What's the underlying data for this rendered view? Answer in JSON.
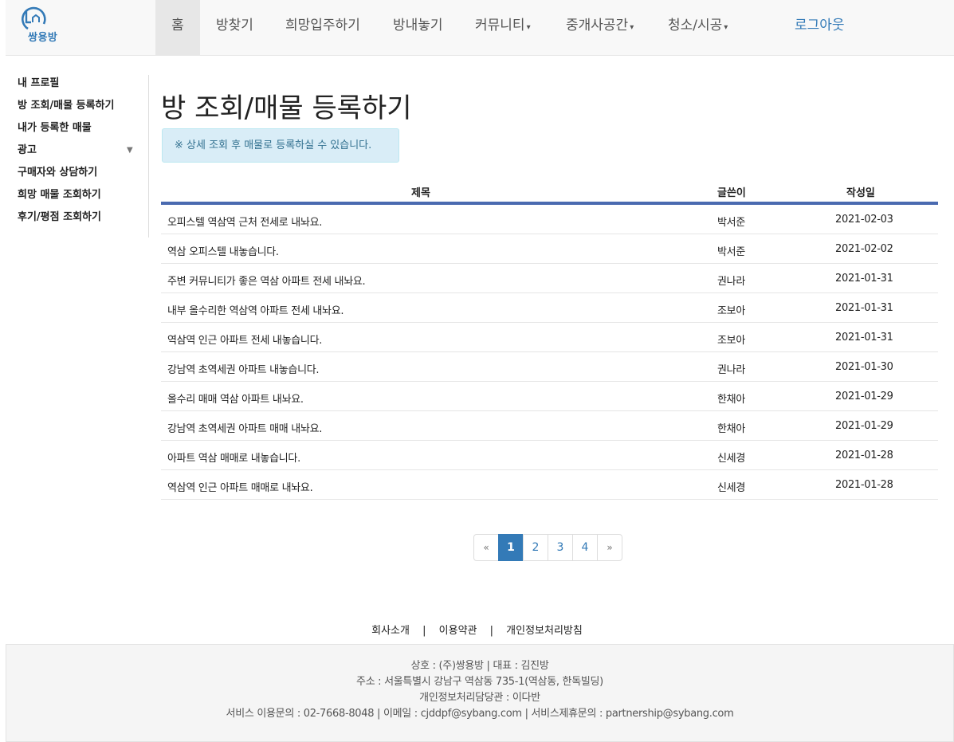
{
  "brand": {
    "logo_text": "쌍용방"
  },
  "nav": {
    "items": [
      {
        "label": "홈"
      },
      {
        "label": "방찾기"
      },
      {
        "label": "희망입주하기"
      },
      {
        "label": "방내놓기"
      },
      {
        "label": "커뮤니티"
      },
      {
        "label": "중개사공간"
      },
      {
        "label": "청소/시공"
      }
    ],
    "logout": "로그아웃"
  },
  "sidebar": {
    "items": [
      {
        "label": "내 프로필"
      },
      {
        "label": "방 조회/매물 등록하기"
      },
      {
        "label": "내가 등록한 매물"
      },
      {
        "label": "광고"
      },
      {
        "label": "구매자와 상담하기"
      },
      {
        "label": "희망 매물 조회하기"
      },
      {
        "label": "후기/평점 조회하기"
      }
    ]
  },
  "main": {
    "title": "방 조회/매물 등록하기",
    "notice": "※ 상세 조회 후 매물로 등록하실 수 있습니다."
  },
  "table": {
    "headers": {
      "title": "제목",
      "author": "글쓴이",
      "date": "작성일"
    },
    "rows": [
      {
        "title": "오피스텔 역삼역 근처 전세로 내놔요.",
        "author": "박서준",
        "date": "2021-02-03"
      },
      {
        "title": "역삼 오피스텔 내놓습니다.",
        "author": "박서준",
        "date": "2021-02-02"
      },
      {
        "title": "주변 커뮤니티가 좋은 역삼 아파트 전세 내놔요.",
        "author": "권나라",
        "date": "2021-01-31"
      },
      {
        "title": "내부 올수리한 역삼역 아파트 전세 내놔요.",
        "author": "조보아",
        "date": "2021-01-31"
      },
      {
        "title": "역삼역 인근 아파트 전세 내놓습니다.",
        "author": "조보아",
        "date": "2021-01-31"
      },
      {
        "title": "강남역 초역세권 아파트 내놓습니다.",
        "author": "권나라",
        "date": "2021-01-30"
      },
      {
        "title": "올수리 매매 역삼 아파트 내놔요.",
        "author": "한채아",
        "date": "2021-01-29"
      },
      {
        "title": "강남역 초역세권 아파트 매매 내놔요.",
        "author": "한채아",
        "date": "2021-01-29"
      },
      {
        "title": "아파트 역삼 매매로 내놓습니다.",
        "author": "신세경",
        "date": "2021-01-28"
      },
      {
        "title": "역삼역 인근 아파트 매매로 내놔요.",
        "author": "신세경",
        "date": "2021-01-28"
      }
    ]
  },
  "pagination": {
    "prev": "«",
    "pages": [
      "1",
      "2",
      "3",
      "4"
    ],
    "next": "»",
    "current": "1"
  },
  "footer": {
    "links": [
      "회사소개",
      "이용약관",
      "개인정보처리방침"
    ],
    "separator": "|",
    "lines": [
      "상호 : (주)쌍용방 | 대표 : 김진방",
      "주소 : 서울특별시 강남구 역삼동 735-1(역삼동, 한독빌딩)",
      "개인정보처리담당관 : 이다반",
      "서비스 이용문의 : 02-7668-8048 | 이메일 : cjddpf@sybang.com | 서비스제휴문의 : partnership@sybang.com"
    ]
  },
  "colors": {
    "accent": "#337ab7",
    "table_rule": "#4a6ab0",
    "notice_bg": "#d9edf7"
  }
}
